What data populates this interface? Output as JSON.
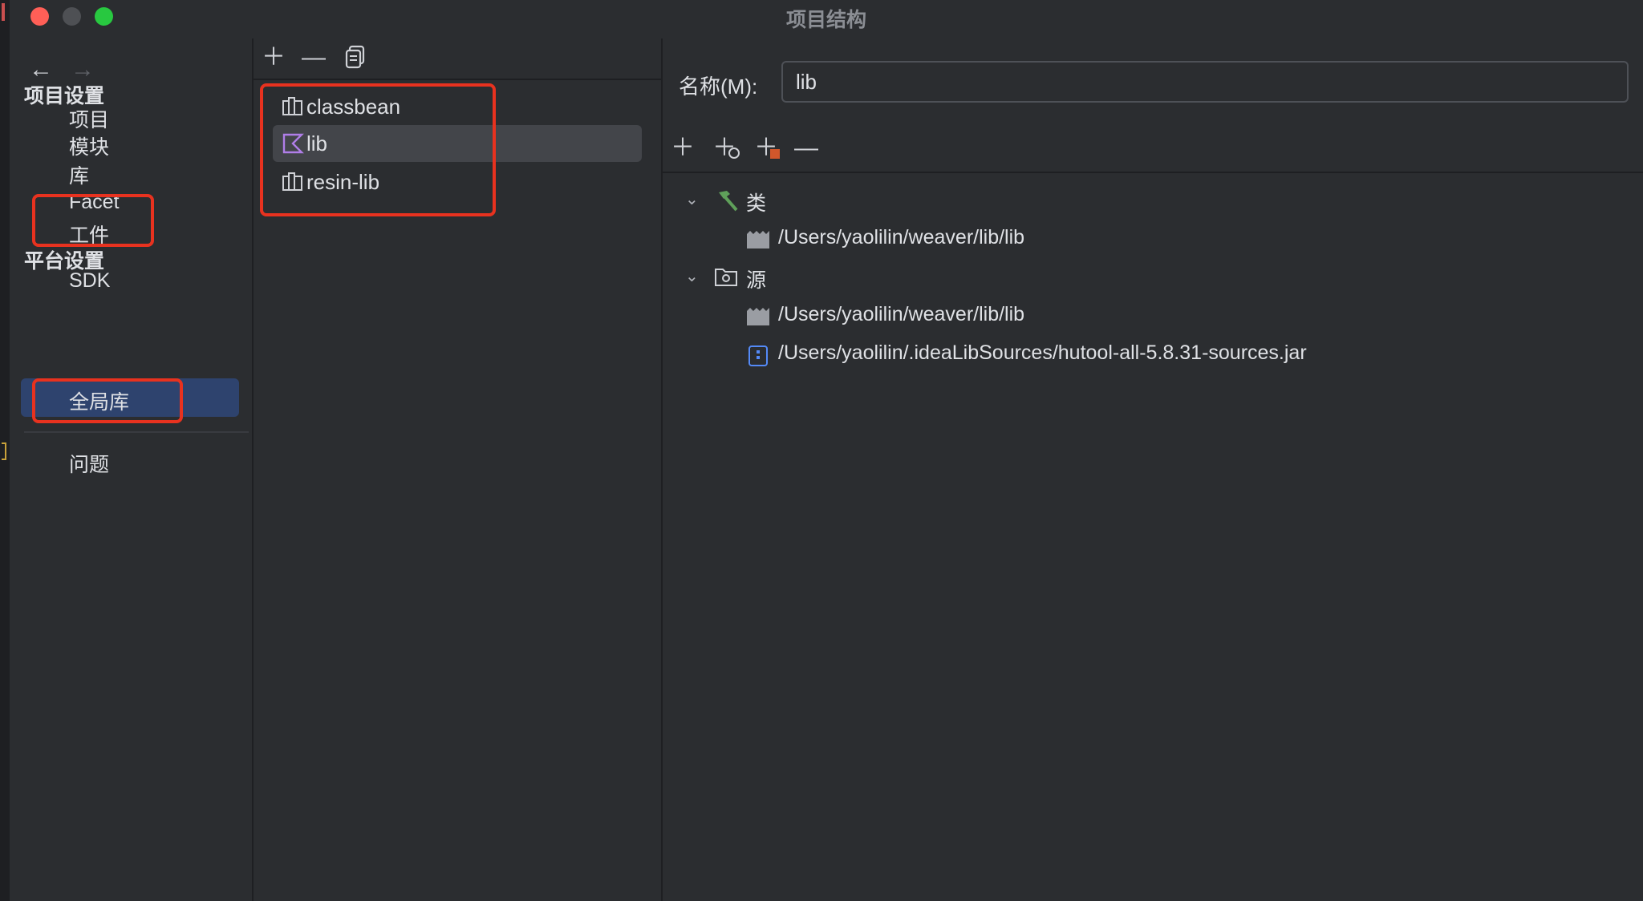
{
  "window": {
    "title": "项目结构"
  },
  "sidebar": {
    "project_settings_header": "项目设置",
    "platform_settings_header": "平台设置",
    "items": {
      "project": "项目",
      "modules": "模块",
      "libraries": "库",
      "facets": "Facet",
      "artifacts": "工件",
      "sdk": "SDK",
      "global_libraries": "全局库",
      "problems": "问题"
    },
    "selected": "全局库"
  },
  "libraries": {
    "items": [
      {
        "label": "classbean",
        "icon": "library-icon",
        "selected": false
      },
      {
        "label": "lib",
        "icon": "kotlin-library-icon",
        "selected": true
      },
      {
        "label": "resin-lib",
        "icon": "library-icon",
        "selected": false
      }
    ]
  },
  "details": {
    "name_label": "名称(M):",
    "name_value": "lib",
    "tree": {
      "classes_label": "类",
      "classes_paths": [
        "/Users/yaolilin/weaver/lib/lib"
      ],
      "sources_label": "源",
      "sources_paths": [
        "/Users/yaolilin/weaver/lib/lib",
        "/Users/yaolilin/.ideaLibSources/hutool-all-5.8.31-sources.jar"
      ]
    }
  },
  "colors": {
    "background": "#2b2d30",
    "selection_blue": "#2e436e",
    "selection_gray": "#43454a",
    "highlight_red": "#e8321f",
    "text": "#dfe1e5"
  }
}
